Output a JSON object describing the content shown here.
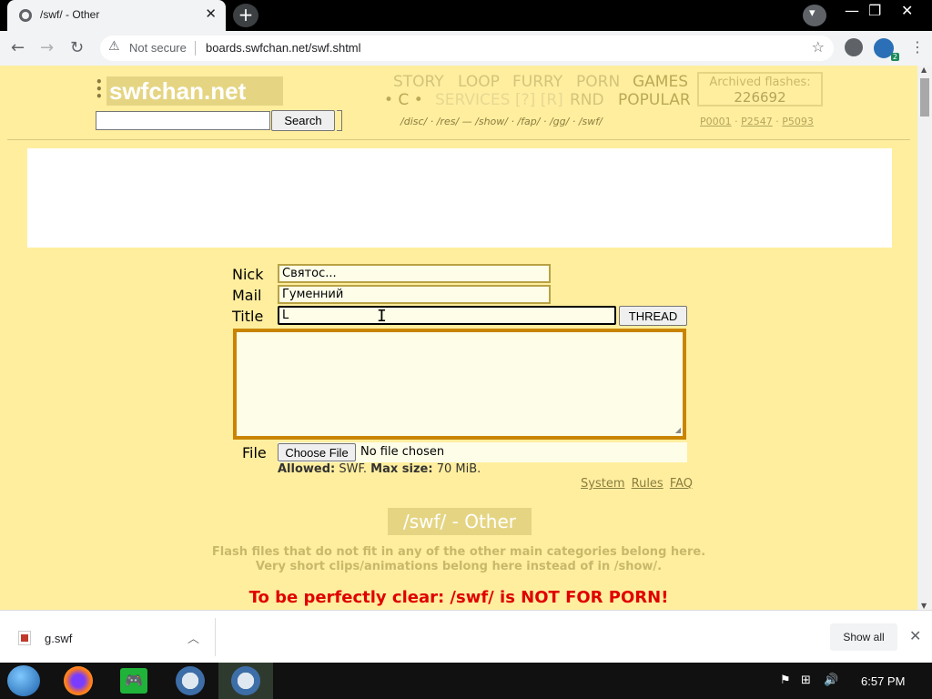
{
  "browser": {
    "tab_title": "/swf/ - Other",
    "tab_close": "✕",
    "new_tab": "+",
    "security": "Not secure",
    "url": "boards.swfchan.net/swf.shtml",
    "ext_badge": "2",
    "window_controls": [
      "—",
      "❐",
      "✕"
    ]
  },
  "header": {
    "logo": "swfchan.net",
    "search_button": "Search",
    "categories_row1": [
      "STORY",
      "LOOP",
      "FURRY",
      "PORN",
      "GAMES"
    ],
    "categories_row2_left": "• C •",
    "categories_row2_services": "SERVICES",
    "categories_row2_qr": "[?] [R]",
    "categories_row2_rnd": "RND",
    "categories_row2_popular": "POPULAR",
    "boards_line": "/disc/ · /res/  —  /show/ · /fap/ · /gg/ · /swf/",
    "archived_label": "Archived flashes:",
    "archived_count": "226692",
    "page_links": [
      "P0001",
      "P2547",
      "P5093"
    ]
  },
  "form": {
    "nick_label": "Nick",
    "nick_value": "Святос...",
    "mail_label": "Mail",
    "mail_value": "Гуменний",
    "title_label": "Title",
    "title_value": "L",
    "thread_button": "THREAD",
    "file_label": "File",
    "choose_file": "Choose File",
    "file_status": "No file chosen",
    "allowed_label": "Allowed:",
    "allowed_value": "SWF.",
    "maxsize_label": "Max size:",
    "maxsize_value": "70 MiB.",
    "links": [
      "System",
      "Rules",
      "FAQ"
    ]
  },
  "board": {
    "title": "/swf/ - Other",
    "desc1": "Flash files that do not fit in any of the other main categories belong here.",
    "desc2": "Very short clips/animations belong here instead of in /show/.",
    "warning": "To be perfectly clear: /swf/ is NOT FOR PORN!"
  },
  "downloads": {
    "file": "g.swf",
    "show_all": "Show all"
  },
  "taskbar": {
    "clock": "6:57 PM"
  },
  "colors": {
    "page_bg": "#ffee9e",
    "logo_bg": "#e5d583",
    "textarea_border": "#c98400",
    "warning": "#e00000"
  }
}
